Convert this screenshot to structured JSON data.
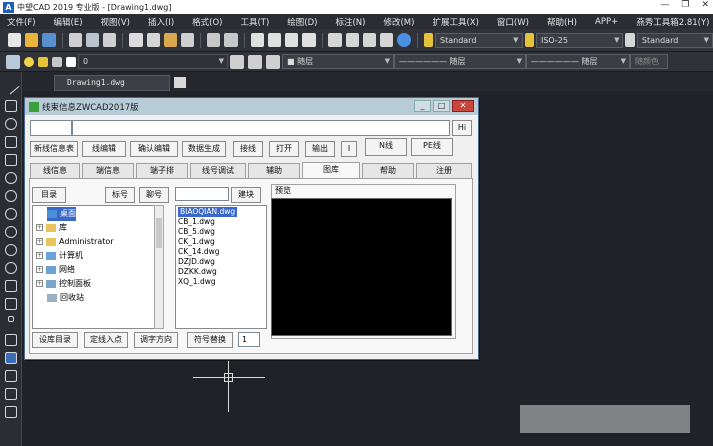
{
  "window": {
    "title": "中望CAD 2019 专业版 - [Drawing1.dwg]",
    "logo_text": "A",
    "controls": {
      "minimize": "—",
      "maximize": "❐",
      "close": "✕"
    }
  },
  "menubar": [
    "文件(F)",
    "编辑(E)",
    "视图(V)",
    "插入(I)",
    "格式(O)",
    "工具(T)",
    "绘图(D)",
    "标注(N)",
    "修改(M)",
    "扩展工具(X)",
    "窗口(W)",
    "帮助(H)",
    "APP+",
    "燕秀工具箱2.81(Y)"
  ],
  "toolbar": {
    "text_style": "Standard",
    "dim_style": "ISO-25",
    "table_style": "Standard",
    "layer_value": "0",
    "color": "■ 随层",
    "linetype": "—————— 随层",
    "lineweight": "—————— 随层",
    "plotstyle": "随颜色"
  },
  "file_tab": {
    "name": "Drawing1.dwg"
  },
  "dialog": {
    "title": "线束信息ZWCAD2017版",
    "hi_button": "Hi",
    "action_buttons": [
      "新线信息表",
      "线编辑",
      "确认编辑",
      "数据生成",
      "接线",
      "打开",
      "输出",
      "I",
      "N线",
      "PE线"
    ],
    "tabs": [
      "线信息",
      "端信息",
      "端子排",
      "线号调试",
      "辅助",
      "图库",
      "帮助",
      "注册"
    ],
    "active_tab": "图库",
    "panel": {
      "path_button": "目录",
      "label_button": "标号",
      "merge_button": "聊号",
      "build_button": "建块",
      "tree": [
        {
          "label": "桌面",
          "selected": true
        },
        {
          "label": "库"
        },
        {
          "label": "Administrator"
        },
        {
          "label": "计算机"
        },
        {
          "label": "网络"
        },
        {
          "label": "控制面板"
        },
        {
          "label": "回收站"
        }
      ],
      "files": [
        "BIAOQIAN.dwg",
        "CB_1.dwg",
        "CB_5.dwg",
        "CK_1.dwg",
        "CK_14.dwg",
        "DZJD.dwg",
        "DZKK.dwg",
        "XQ_1.dwg"
      ],
      "preview_label": "预览",
      "bottom_buttons": [
        "设库目录",
        "定线入点",
        "调字方向",
        "符号替换"
      ],
      "bottom_value": "1"
    }
  }
}
